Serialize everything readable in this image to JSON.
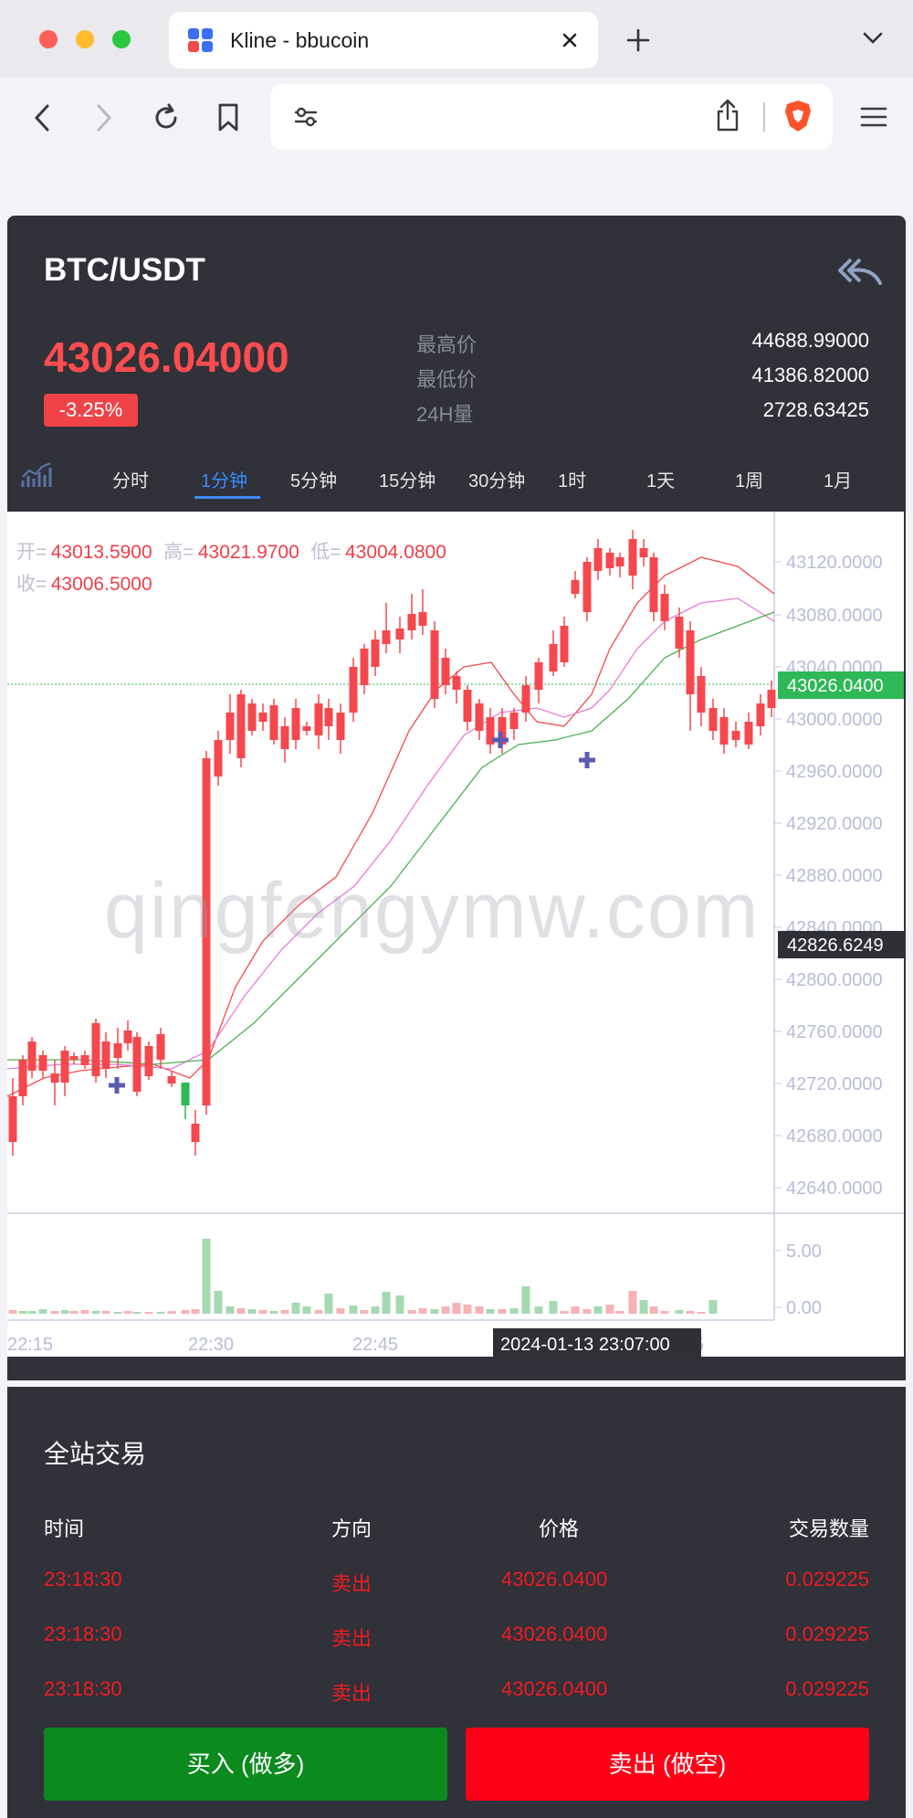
{
  "browser": {
    "tab_title": "Kline - bbucoin"
  },
  "market": {
    "pair": "BTC/USDT",
    "last_price": "43026.04000",
    "change_pct": "-3.25%",
    "stats": [
      {
        "label": "最高价",
        "value": "44688.99000"
      },
      {
        "label": "最低价",
        "value": "41386.82000"
      },
      {
        "label": "24H量",
        "value": "2728.63425"
      }
    ]
  },
  "periods": [
    "分时",
    "1分钟",
    "5分钟",
    "15分钟",
    "30分钟",
    "1时",
    "1天",
    "1周",
    "1月"
  ],
  "active_period": "1分钟",
  "ohlc": {
    "open_label": "开=",
    "open": "43013.5900",
    "high_label": "高=",
    "high": "43021.9700",
    "low_label": "低=",
    "low": "43004.0800",
    "close_label": "收=",
    "close": "43006.5000"
  },
  "watermark": "qingfengymw.com",
  "chart_data": {
    "type": "candlestick",
    "y_ticks": [
      "43120.0000",
      "43080.0000",
      "43040.0000",
      "43000.0000",
      "42960.0000",
      "42920.0000",
      "42880.0000",
      "42840.0000",
      "42800.0000",
      "42760.0000",
      "42720.0000",
      "42680.0000",
      "42640.0000"
    ],
    "last_price_tag": "43026.0400",
    "crosshair_price_tag": "42826.6249",
    "crosshair_time": "2024-01-13 23:07:00",
    "x_ticks": [
      "22:15",
      "22:30",
      "22:45",
      "5"
    ],
    "volume_ticks": [
      "5.00",
      "0.00"
    ],
    "colors": {
      "up": "#2eb857",
      "down": "#f5484e",
      "ma_fast": "#f5484e",
      "ma_mid": "#e67ad6",
      "ma_slow": "#4caf50"
    }
  },
  "trades": {
    "title": "全站交易",
    "headers": [
      "时间",
      "方向",
      "价格",
      "交易数量"
    ],
    "rows": [
      {
        "time": "23:18:30",
        "side": "卖出",
        "price": "43026.0400",
        "qty": "0.029225"
      },
      {
        "time": "23:18:30",
        "side": "卖出",
        "price": "43026.0400",
        "qty": "0.029225"
      },
      {
        "time": "23:18:30",
        "side": "卖出",
        "price": "43026.0400",
        "qty": "0.029225"
      }
    ]
  },
  "actions": {
    "buy": "买入 (做多)",
    "sell": "卖出 (做空)"
  }
}
